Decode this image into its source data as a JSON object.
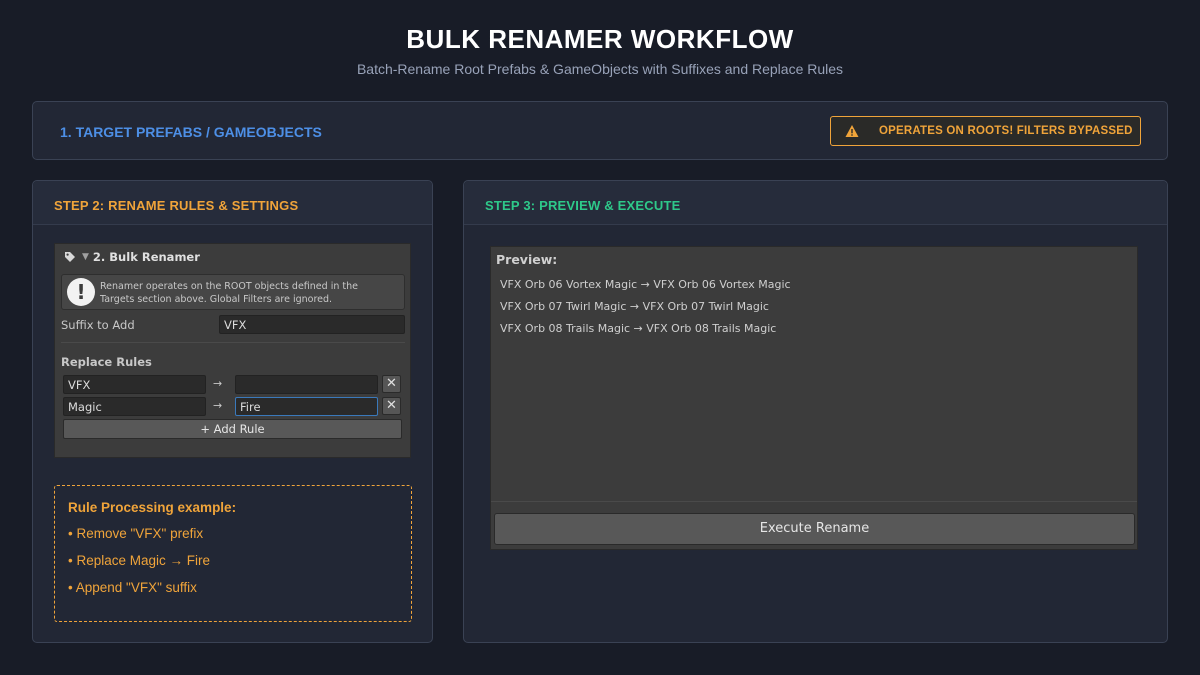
{
  "header": {
    "title": "BULK RENAMER WORKFLOW",
    "subtitle": "Batch-Rename Root Prefabs & GameObjects with Suffixes and Replace Rules"
  },
  "target_panel": {
    "title": "1. TARGET PREFABS / GAMEOBJECTS",
    "warning": "OPERATES ON ROOTS! FILTERS BYPASSED",
    "warning_icon": "warning-triangle-icon"
  },
  "step2": {
    "title": "STEP 2: RENAME RULES & SETTINGS",
    "inspector": {
      "header": "2. Bulk Renamer",
      "header_icon": "tag-icon",
      "help_icon": "!",
      "help_line1": "Renamer operates on the ROOT objects defined in the",
      "help_line2": "Targets section above. Global Filters are ignored.",
      "suffix_label": "Suffix to Add",
      "suffix_value": "VFX",
      "replace_rules_label": "Replace Rules",
      "arrow": "→",
      "rules": [
        {
          "find": "VFX",
          "replace": ""
        },
        {
          "find": "Magic",
          "replace": "Fire"
        }
      ],
      "remove_label": "✕",
      "add_rule_label": "+ Add Rule"
    },
    "example": {
      "title": "Rule Processing example:",
      "lines": [
        "• Remove \"VFX\" prefix",
        "• Replace Magic → Fire",
        "• Append \"VFX\" suffix"
      ]
    }
  },
  "step3": {
    "title": "STEP 3: PREVIEW & EXECUTE",
    "preview_label": "Preview:",
    "preview_lines": [
      "VFX Orb 06 Vortex Magic → VFX Orb 06 Vortex Magic",
      "VFX Orb 07 Twirl Magic → VFX Orb 07 Twirl Magic",
      "VFX Orb 08 Trails Magic → VFX Orb 08 Trails Magic"
    ],
    "execute_label": "Execute Rename"
  },
  "colors": {
    "background": "#181c27",
    "panel": "#222735",
    "accent_blue": "#4d8fe6",
    "accent_orange": "#f0a43a",
    "accent_green": "#2ec98a"
  }
}
